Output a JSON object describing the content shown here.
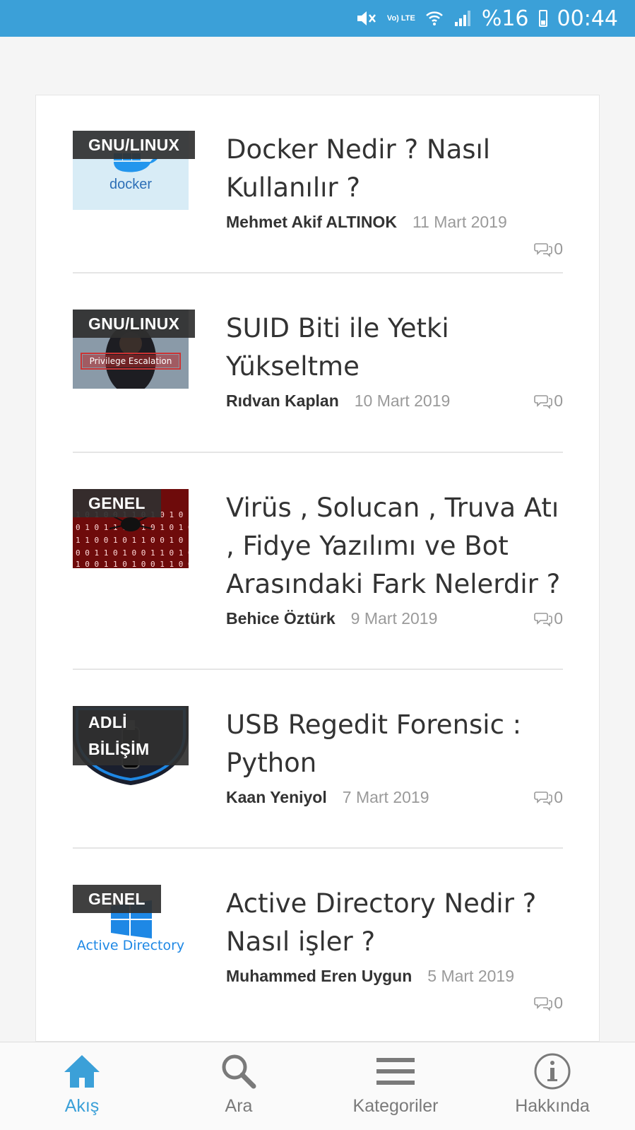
{
  "status_bar": {
    "battery_text": "%16",
    "time": "00:44",
    "network": "Vo) LTE"
  },
  "posts": [
    {
      "category": "GNU/LINUX",
      "thumb_text": "docker",
      "title": "Docker Nedir ? Nasıl Kullanılır ?",
      "author": "Mehmet Akif ALTINOK",
      "date": "11 Mart 2019",
      "comments": "0"
    },
    {
      "category": "GNU/LINUX",
      "thumb_text": "Privilege Escalation",
      "title": "SUID Biti ile Yetki Yükseltme",
      "author": "Rıdvan Kaplan",
      "date": "10 Mart 2019",
      "comments": "0"
    },
    {
      "category": "GENEL",
      "thumb_text": "",
      "title": "Virüs , Solucan , Truva Atı , Fidye Yazılımı ve Bot Arasındaki Fark Nelerdir ?",
      "author": "Behice Öztürk",
      "date": "9 Mart 2019",
      "comments": "0"
    },
    {
      "category": "ADLİ BİLİŞİM",
      "thumb_text": "",
      "title": "USB Regedit Forensic : Python",
      "author": "Kaan Yeniyol",
      "date": "7 Mart 2019",
      "comments": "0"
    },
    {
      "category": "GENEL",
      "thumb_text": "Active Directory",
      "title": "Active Directory Nedir ? Nasıl işler ?",
      "author": "Muhammed Eren Uygun",
      "date": "5 Mart 2019",
      "comments": "0"
    }
  ],
  "bottom_nav": [
    {
      "label": "Akış",
      "icon": "home-icon",
      "active": true
    },
    {
      "label": "Ara",
      "icon": "search-icon",
      "active": false
    },
    {
      "label": "Kategoriler",
      "icon": "menu-icon",
      "active": false
    },
    {
      "label": "Hakkında",
      "icon": "info-icon",
      "active": false
    }
  ],
  "colors": {
    "accent": "#3ba0d8",
    "category_bg": "#303030",
    "title_text": "#333333",
    "meta_text": "#9a9a9a"
  }
}
